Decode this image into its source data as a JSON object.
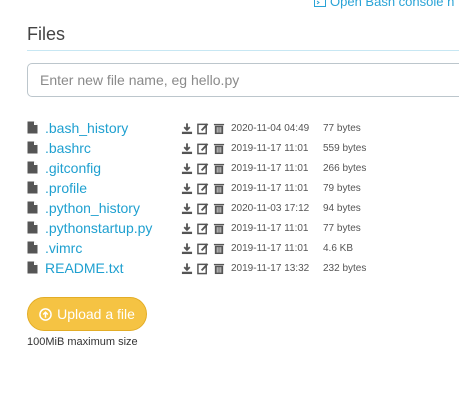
{
  "header": {
    "console_link": "Open Bash console h",
    "title": "Files"
  },
  "new_file": {
    "placeholder": "Enter new file name, eg hello.py"
  },
  "files": [
    {
      "name": ".bash_history",
      "date": "2020-11-04 04:49",
      "size": "77 bytes"
    },
    {
      "name": ".bashrc",
      "date": "2019-11-17 11:01",
      "size": "559 bytes"
    },
    {
      "name": ".gitconfig",
      "date": "2019-11-17 11:01",
      "size": "266 bytes"
    },
    {
      "name": ".profile",
      "date": "2019-11-17 11:01",
      "size": "79 bytes"
    },
    {
      "name": ".python_history",
      "date": "2020-11-03 17:12",
      "size": "94 bytes"
    },
    {
      "name": ".pythonstartup.py",
      "date": "2019-11-17 11:01",
      "size": "77 bytes"
    },
    {
      "name": ".vimrc",
      "date": "2019-11-17 11:01",
      "size": "4.6 KB"
    },
    {
      "name": "README.txt",
      "date": "2019-11-17 13:32",
      "size": "232 bytes"
    }
  ],
  "upload": {
    "button_label": "Upload a file",
    "note": "100MiB maximum size"
  },
  "colors": {
    "link": "#1fa0d0",
    "upload_button": "#f5c343",
    "icon": "#555555"
  },
  "icons": {
    "file": "file-icon",
    "download": "download-icon",
    "edit": "edit-icon",
    "delete": "trash-icon",
    "upload": "upload-circle-icon",
    "console": "terminal-icon"
  }
}
